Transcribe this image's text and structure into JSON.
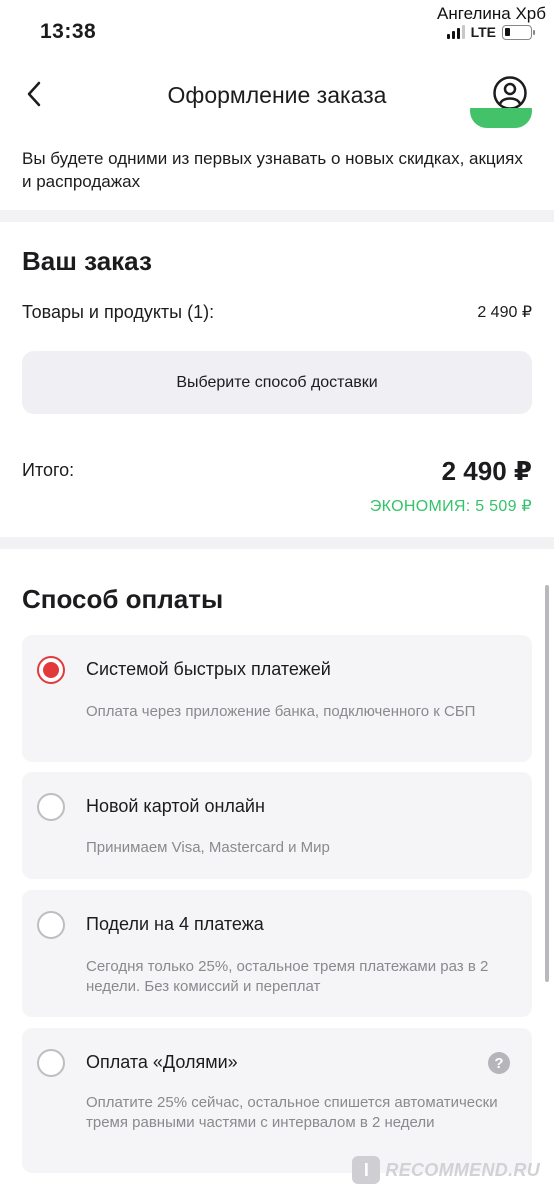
{
  "status_bar": {
    "time": "13:38",
    "user_name": "Ангелина Хрб",
    "network": "LTE",
    "battery_level": 0.2
  },
  "header": {
    "title": "Оформление заказа",
    "back_icon": "chevron-left-icon",
    "profile_icon": "user-circle-icon"
  },
  "subscription": {
    "text": "Вы будете одними из первых узнавать о новых скидках, акциях и распродажах",
    "toggle_on": true
  },
  "order": {
    "title": "Ваш заказ",
    "items_label": "Товары и продукты (1):",
    "items_price": "2 490 ₽",
    "delivery_button": "Выберите способ доставки",
    "total_label": "Итого:",
    "total_value": "2 490 ₽",
    "economy": "ЭКОНОМИЯ: 5 509 ₽"
  },
  "payment": {
    "title": "Способ оплаты",
    "options": [
      {
        "title": "Системой быстрых платежей",
        "desc": "Оплата через приложение банка, подключенного к СБП",
        "selected": true
      },
      {
        "title": "Новой картой онлайн",
        "desc": "Принимаем Visa, Mastercard и Мир",
        "selected": false
      },
      {
        "title": "Подели на 4 платежа",
        "desc": "Сегодня только 25%, остальное тремя платежами раз в 2 недели. Без комиссий и переплат",
        "selected": false
      },
      {
        "title": "Оплата «Долями»",
        "desc": "Оплатите 25% сейчас, остальное спишется автоматически тремя равными частями с интервалом в 2 недели",
        "selected": false,
        "help": "?"
      }
    ]
  },
  "watermark": {
    "logo": "I",
    "text": "RECOMMEND.RU"
  },
  "colors": {
    "accent_red": "#e23a3a",
    "economy_green": "#36c26a",
    "toggle_green": "#43c26a",
    "card_bg": "#f5f5f7"
  }
}
